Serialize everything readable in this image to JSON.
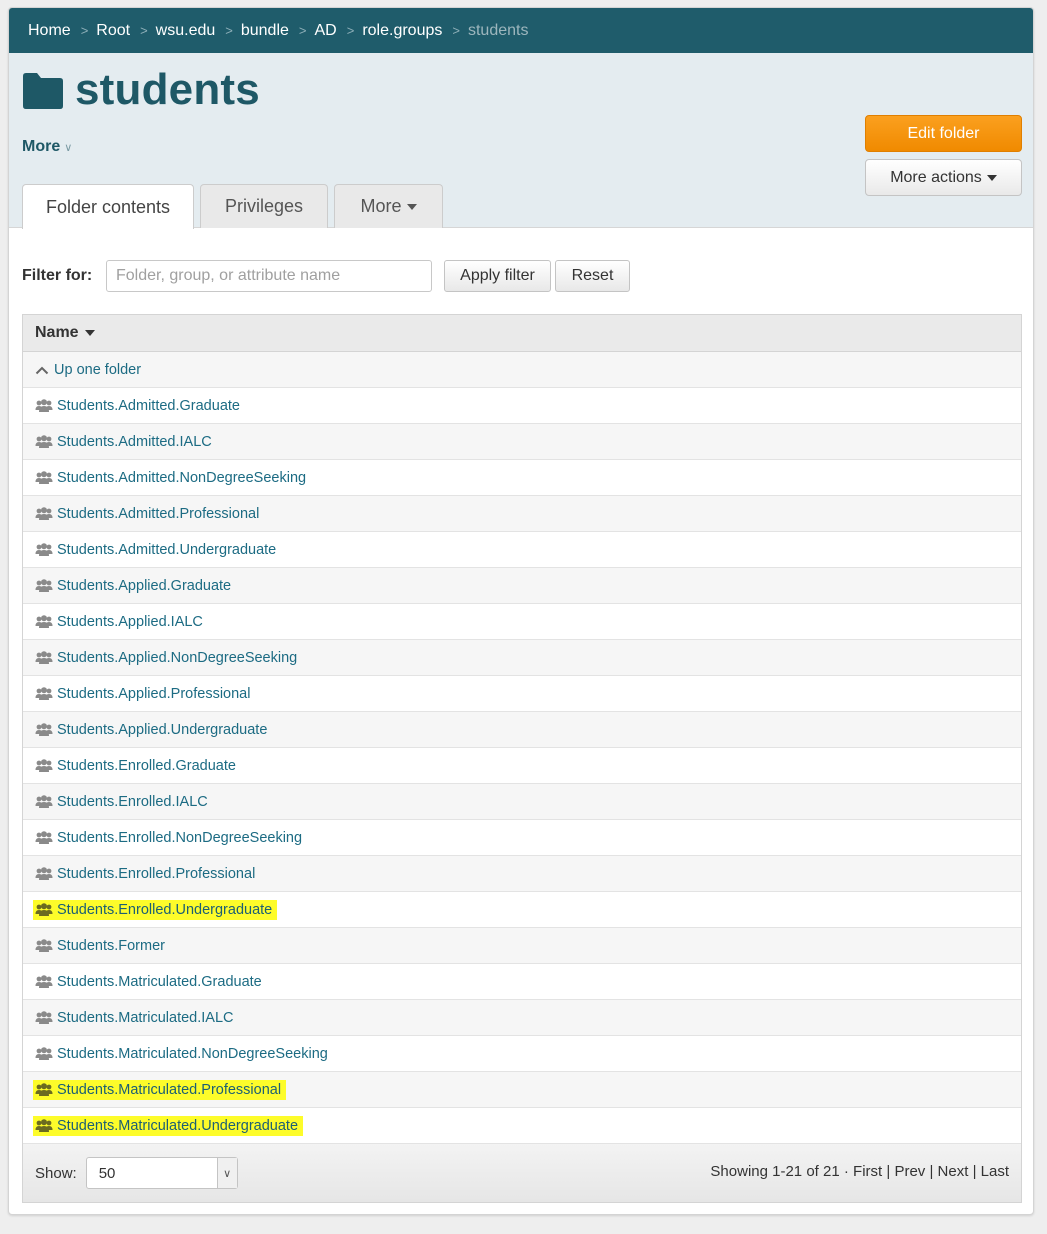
{
  "breadcrumb": {
    "items": [
      "Home",
      "Root",
      "wsu.edu",
      "bundle",
      "AD",
      "role.groups"
    ],
    "current": "students",
    "separator": ">"
  },
  "header": {
    "title": "students",
    "more_label": "More",
    "edit_folder_label": "Edit folder",
    "more_actions_label": "More actions"
  },
  "tabs": {
    "folder_contents": "Folder contents",
    "privileges": "Privileges",
    "more": "More"
  },
  "filter": {
    "label": "Filter for:",
    "placeholder": "Folder, group, or attribute name",
    "apply_label": "Apply filter",
    "reset_label": "Reset"
  },
  "table": {
    "header": "Name",
    "up_label": "Up one folder",
    "rows": [
      {
        "name": "Students.Admitted.Graduate",
        "highlighted": false
      },
      {
        "name": "Students.Admitted.IALC",
        "highlighted": false
      },
      {
        "name": "Students.Admitted.NonDegreeSeeking",
        "highlighted": false
      },
      {
        "name": "Students.Admitted.Professional",
        "highlighted": false
      },
      {
        "name": "Students.Admitted.Undergraduate",
        "highlighted": false
      },
      {
        "name": "Students.Applied.Graduate",
        "highlighted": false
      },
      {
        "name": "Students.Applied.IALC",
        "highlighted": false
      },
      {
        "name": "Students.Applied.NonDegreeSeeking",
        "highlighted": false
      },
      {
        "name": "Students.Applied.Professional",
        "highlighted": false
      },
      {
        "name": "Students.Applied.Undergraduate",
        "highlighted": false
      },
      {
        "name": "Students.Enrolled.Graduate",
        "highlighted": false
      },
      {
        "name": "Students.Enrolled.IALC",
        "highlighted": false
      },
      {
        "name": "Students.Enrolled.NonDegreeSeeking",
        "highlighted": false
      },
      {
        "name": "Students.Enrolled.Professional",
        "highlighted": false
      },
      {
        "name": "Students.Enrolled.Undergraduate",
        "highlighted": true
      },
      {
        "name": "Students.Former",
        "highlighted": false
      },
      {
        "name": "Students.Matriculated.Graduate",
        "highlighted": false
      },
      {
        "name": "Students.Matriculated.IALC",
        "highlighted": false
      },
      {
        "name": "Students.Matriculated.NonDegreeSeeking",
        "highlighted": false
      },
      {
        "name": "Students.Matriculated.Professional",
        "highlighted": true
      },
      {
        "name": "Students.Matriculated.Undergraduate",
        "highlighted": true
      }
    ]
  },
  "footer": {
    "show_label": "Show:",
    "page_size": "50",
    "showing_text": "Showing 1-21 of 21",
    "dot": "·",
    "first": "First",
    "prev": "Prev",
    "next": "Next",
    "last": "Last",
    "pipe": "|"
  },
  "colors": {
    "brand_bar": "#1f5c6b",
    "title": "#1e5866",
    "link": "#1c6b83",
    "accent_button": "#f7941d",
    "highlight": "#fdfc2a"
  },
  "icons": {
    "folder": "folder-icon",
    "group": "group-icon",
    "up": "chevron-up-icon",
    "caret": "caret-down-icon"
  }
}
